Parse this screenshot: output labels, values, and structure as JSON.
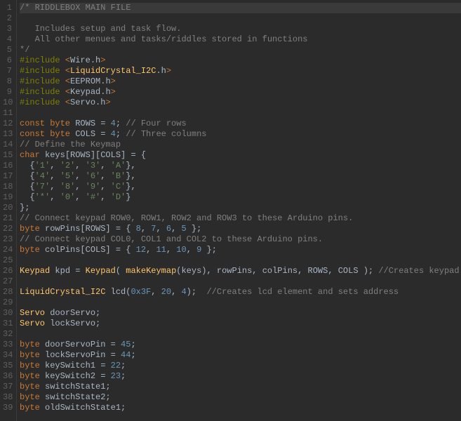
{
  "lines": [
    {
      "n": "1",
      "spans": [
        {
          "c": "t-comment",
          "t": "/* RIDDLEBOX MAIN FILE"
        }
      ],
      "cls": "line1"
    },
    {
      "n": "2",
      "spans": [
        {
          "c": "t-comment",
          "t": ""
        }
      ]
    },
    {
      "n": "3",
      "spans": [
        {
          "c": "t-comment",
          "t": "   Includes setup and task flow."
        }
      ]
    },
    {
      "n": "4",
      "spans": [
        {
          "c": "t-comment",
          "t": "   All other menues and tasks/riddles stored in functions"
        }
      ]
    },
    {
      "n": "5",
      "spans": [
        {
          "c": "t-comment",
          "t": "*/"
        }
      ]
    },
    {
      "n": "6",
      "spans": [
        {
          "c": "t-preproc",
          "t": "#include "
        },
        {
          "c": "t-include-lib",
          "t": "<"
        },
        {
          "c": "t-ident",
          "t": "Wire"
        },
        {
          "c": "t-punct",
          "t": "."
        },
        {
          "c": "t-ident",
          "t": "h"
        },
        {
          "c": "t-include-lib",
          "t": ">"
        }
      ]
    },
    {
      "n": "7",
      "spans": [
        {
          "c": "t-preproc",
          "t": "#include "
        },
        {
          "c": "t-include-lib",
          "t": "<"
        },
        {
          "c": "t-classname",
          "t": "LiquidCrystal_I2C"
        },
        {
          "c": "t-punct",
          "t": "."
        },
        {
          "c": "t-ident",
          "t": "h"
        },
        {
          "c": "t-include-lib",
          "t": ">"
        }
      ]
    },
    {
      "n": "8",
      "spans": [
        {
          "c": "t-preproc",
          "t": "#include "
        },
        {
          "c": "t-include-lib",
          "t": "<"
        },
        {
          "c": "t-ident",
          "t": "EEPROM"
        },
        {
          "c": "t-punct",
          "t": "."
        },
        {
          "c": "t-ident",
          "t": "h"
        },
        {
          "c": "t-include-lib",
          "t": ">"
        }
      ]
    },
    {
      "n": "9",
      "spans": [
        {
          "c": "t-preproc",
          "t": "#include "
        },
        {
          "c": "t-include-lib",
          "t": "<"
        },
        {
          "c": "t-ident",
          "t": "Keypad"
        },
        {
          "c": "t-punct",
          "t": "."
        },
        {
          "c": "t-ident",
          "t": "h"
        },
        {
          "c": "t-include-lib",
          "t": ">"
        }
      ]
    },
    {
      "n": "10",
      "spans": [
        {
          "c": "t-preproc",
          "t": "#include "
        },
        {
          "c": "t-include-lib",
          "t": "<"
        },
        {
          "c": "t-ident",
          "t": "Servo"
        },
        {
          "c": "t-punct",
          "t": "."
        },
        {
          "c": "t-ident",
          "t": "h"
        },
        {
          "c": "t-include-lib",
          "t": ">"
        }
      ]
    },
    {
      "n": "11",
      "spans": []
    },
    {
      "n": "12",
      "spans": [
        {
          "c": "t-keyword",
          "t": "const byte"
        },
        {
          "c": "t-ident",
          "t": " ROWS "
        },
        {
          "c": "t-punct",
          "t": "= "
        },
        {
          "c": "t-number",
          "t": "4"
        },
        {
          "c": "t-punct",
          "t": "; "
        },
        {
          "c": "t-comment",
          "t": "// Four rows"
        }
      ]
    },
    {
      "n": "13",
      "spans": [
        {
          "c": "t-keyword",
          "t": "const byte"
        },
        {
          "c": "t-ident",
          "t": " COLS "
        },
        {
          "c": "t-punct",
          "t": "= "
        },
        {
          "c": "t-number",
          "t": "4"
        },
        {
          "c": "t-punct",
          "t": "; "
        },
        {
          "c": "t-comment",
          "t": "// Three columns"
        }
      ]
    },
    {
      "n": "14",
      "spans": [
        {
          "c": "t-comment",
          "t": "// Define the Keymap"
        }
      ]
    },
    {
      "n": "15",
      "spans": [
        {
          "c": "t-keyword",
          "t": "char"
        },
        {
          "c": "t-ident",
          "t": " keys[ROWS][COLS] "
        },
        {
          "c": "t-punct",
          "t": "= {"
        }
      ]
    },
    {
      "n": "16",
      "spans": [
        {
          "c": "t-punct",
          "t": "  {"
        },
        {
          "c": "t-string",
          "t": "'1'"
        },
        {
          "c": "t-punct",
          "t": ", "
        },
        {
          "c": "t-string",
          "t": "'2'"
        },
        {
          "c": "t-punct",
          "t": ", "
        },
        {
          "c": "t-string",
          "t": "'3'"
        },
        {
          "c": "t-punct",
          "t": ", "
        },
        {
          "c": "t-string",
          "t": "'A'"
        },
        {
          "c": "t-punct",
          "t": "},"
        }
      ]
    },
    {
      "n": "17",
      "spans": [
        {
          "c": "t-punct",
          "t": "  {"
        },
        {
          "c": "t-string",
          "t": "'4'"
        },
        {
          "c": "t-punct",
          "t": ", "
        },
        {
          "c": "t-string",
          "t": "'5'"
        },
        {
          "c": "t-punct",
          "t": ", "
        },
        {
          "c": "t-string",
          "t": "'6'"
        },
        {
          "c": "t-punct",
          "t": ", "
        },
        {
          "c": "t-string",
          "t": "'B'"
        },
        {
          "c": "t-punct",
          "t": "},"
        }
      ]
    },
    {
      "n": "18",
      "spans": [
        {
          "c": "t-punct",
          "t": "  {"
        },
        {
          "c": "t-string",
          "t": "'7'"
        },
        {
          "c": "t-punct",
          "t": ", "
        },
        {
          "c": "t-string",
          "t": "'8'"
        },
        {
          "c": "t-punct",
          "t": ", "
        },
        {
          "c": "t-string",
          "t": "'9'"
        },
        {
          "c": "t-punct",
          "t": ", "
        },
        {
          "c": "t-string",
          "t": "'C'"
        },
        {
          "c": "t-punct",
          "t": "},"
        }
      ]
    },
    {
      "n": "19",
      "spans": [
        {
          "c": "t-punct",
          "t": "  {"
        },
        {
          "c": "t-string",
          "t": "'*'"
        },
        {
          "c": "t-punct",
          "t": ", "
        },
        {
          "c": "t-string",
          "t": "'0'"
        },
        {
          "c": "t-punct",
          "t": ", "
        },
        {
          "c": "t-string",
          "t": "'#'"
        },
        {
          "c": "t-punct",
          "t": ", "
        },
        {
          "c": "t-string",
          "t": "'D'"
        },
        {
          "c": "t-punct",
          "t": "}"
        }
      ]
    },
    {
      "n": "20",
      "spans": [
        {
          "c": "t-punct",
          "t": "};"
        }
      ]
    },
    {
      "n": "21",
      "spans": [
        {
          "c": "t-comment",
          "t": "// Connect keypad ROW0, ROW1, ROW2 and ROW3 to these Arduino pins."
        }
      ]
    },
    {
      "n": "22",
      "spans": [
        {
          "c": "t-keyword",
          "t": "byte"
        },
        {
          "c": "t-ident",
          "t": " rowPins[ROWS] "
        },
        {
          "c": "t-punct",
          "t": "= { "
        },
        {
          "c": "t-number",
          "t": "8"
        },
        {
          "c": "t-punct",
          "t": ", "
        },
        {
          "c": "t-number",
          "t": "7"
        },
        {
          "c": "t-punct",
          "t": ", "
        },
        {
          "c": "t-number",
          "t": "6"
        },
        {
          "c": "t-punct",
          "t": ", "
        },
        {
          "c": "t-number",
          "t": "5"
        },
        {
          "c": "t-punct",
          "t": " };"
        }
      ]
    },
    {
      "n": "23",
      "spans": [
        {
          "c": "t-comment",
          "t": "// Connect keypad COL0, COL1 and COL2 to these Arduino pins."
        }
      ]
    },
    {
      "n": "24",
      "spans": [
        {
          "c": "t-keyword",
          "t": "byte"
        },
        {
          "c": "t-ident",
          "t": " colPins[COLS] "
        },
        {
          "c": "t-punct",
          "t": "= { "
        },
        {
          "c": "t-number",
          "t": "12"
        },
        {
          "c": "t-punct",
          "t": ", "
        },
        {
          "c": "t-number",
          "t": "11"
        },
        {
          "c": "t-punct",
          "t": ", "
        },
        {
          "c": "t-number",
          "t": "10"
        },
        {
          "c": "t-punct",
          "t": ", "
        },
        {
          "c": "t-number",
          "t": "9"
        },
        {
          "c": "t-punct",
          "t": " };"
        }
      ]
    },
    {
      "n": "25",
      "spans": []
    },
    {
      "n": "26",
      "spans": [
        {
          "c": "t-classname",
          "t": "Keypad"
        },
        {
          "c": "t-ident",
          "t": " kpd "
        },
        {
          "c": "t-punct",
          "t": "= "
        },
        {
          "c": "t-classname",
          "t": "Keypad"
        },
        {
          "c": "t-punct",
          "t": "( "
        },
        {
          "c": "t-func",
          "t": "makeKeymap"
        },
        {
          "c": "t-punct",
          "t": "(keys), rowPins, colPins, ROWS, COLS ); "
        },
        {
          "c": "t-comment",
          "t": "//Creates keypad element"
        }
      ]
    },
    {
      "n": "27",
      "spans": []
    },
    {
      "n": "28",
      "spans": [
        {
          "c": "t-classname",
          "t": "LiquidCrystal_I2C"
        },
        {
          "c": "t-ident",
          "t": " lcd"
        },
        {
          "c": "t-punct",
          "t": "("
        },
        {
          "c": "t-number",
          "t": "0x3F"
        },
        {
          "c": "t-punct",
          "t": ", "
        },
        {
          "c": "t-number",
          "t": "20"
        },
        {
          "c": "t-punct",
          "t": ", "
        },
        {
          "c": "t-number",
          "t": "4"
        },
        {
          "c": "t-punct",
          "t": ");  "
        },
        {
          "c": "t-comment",
          "t": "//Creates lcd element and sets address"
        }
      ]
    },
    {
      "n": "29",
      "spans": []
    },
    {
      "n": "30",
      "spans": [
        {
          "c": "t-classname",
          "t": "Servo"
        },
        {
          "c": "t-ident",
          "t": " doorServo;"
        }
      ]
    },
    {
      "n": "31",
      "spans": [
        {
          "c": "t-classname",
          "t": "Servo"
        },
        {
          "c": "t-ident",
          "t": " lockServo;"
        }
      ]
    },
    {
      "n": "32",
      "spans": []
    },
    {
      "n": "33",
      "spans": [
        {
          "c": "t-keyword",
          "t": "byte"
        },
        {
          "c": "t-ident",
          "t": " doorServoPin "
        },
        {
          "c": "t-punct",
          "t": "= "
        },
        {
          "c": "t-number",
          "t": "45"
        },
        {
          "c": "t-punct",
          "t": ";"
        }
      ]
    },
    {
      "n": "34",
      "spans": [
        {
          "c": "t-keyword",
          "t": "byte"
        },
        {
          "c": "t-ident",
          "t": " lockServoPin "
        },
        {
          "c": "t-punct",
          "t": "= "
        },
        {
          "c": "t-number",
          "t": "44"
        },
        {
          "c": "t-punct",
          "t": ";"
        }
      ]
    },
    {
      "n": "35",
      "spans": [
        {
          "c": "t-keyword",
          "t": "byte"
        },
        {
          "c": "t-ident",
          "t": " keySwitch1 "
        },
        {
          "c": "t-punct",
          "t": "= "
        },
        {
          "c": "t-number",
          "t": "22"
        },
        {
          "c": "t-punct",
          "t": ";"
        }
      ]
    },
    {
      "n": "36",
      "spans": [
        {
          "c": "t-keyword",
          "t": "byte"
        },
        {
          "c": "t-ident",
          "t": " keySwitch2 "
        },
        {
          "c": "t-punct",
          "t": "= "
        },
        {
          "c": "t-number",
          "t": "23"
        },
        {
          "c": "t-punct",
          "t": ";"
        }
      ]
    },
    {
      "n": "37",
      "spans": [
        {
          "c": "t-keyword",
          "t": "byte"
        },
        {
          "c": "t-ident",
          "t": " switchState1;"
        }
      ]
    },
    {
      "n": "38",
      "spans": [
        {
          "c": "t-keyword",
          "t": "byte"
        },
        {
          "c": "t-ident",
          "t": " switchState2;"
        }
      ]
    },
    {
      "n": "39",
      "spans": [
        {
          "c": "t-keyword",
          "t": "byte"
        },
        {
          "c": "t-ident",
          "t": " oldSwitchState1;"
        }
      ]
    }
  ]
}
